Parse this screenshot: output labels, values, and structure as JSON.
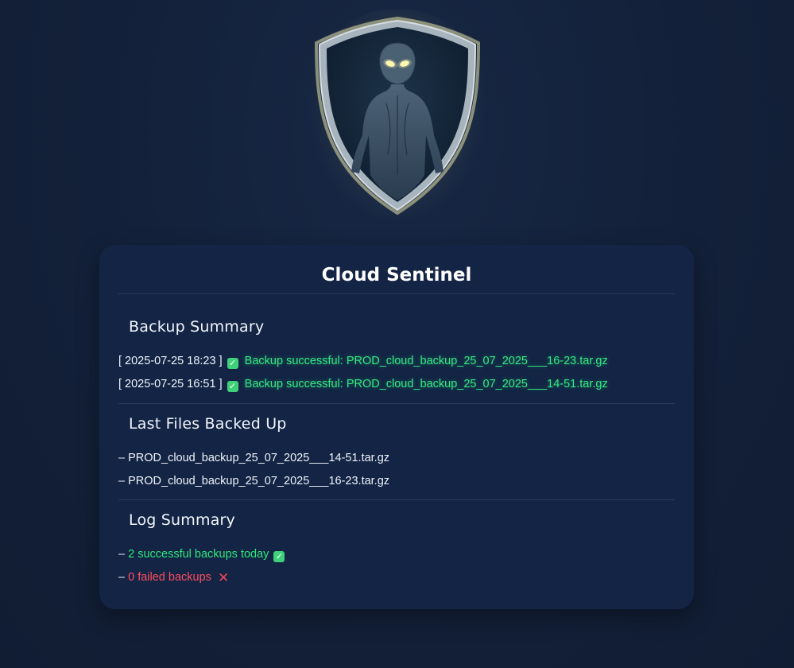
{
  "app": {
    "title": "Cloud Sentinel",
    "logo_icon": "shield-guardian-icon"
  },
  "colors": {
    "background": "#132039",
    "card": "#132445",
    "success": "#2ee87c",
    "error": "#ff4d5e",
    "logo_glow": "#fff096"
  },
  "backup_summary": {
    "heading": "Backup Summary",
    "entries": [
      {
        "timestamp": "[ 2025-07-25 18:23 ]",
        "status_icon": "check-icon",
        "message": "Backup successful: PROD_cloud_backup_25_07_2025___16-23.tar.gz"
      },
      {
        "timestamp": "[ 2025-07-25 16:51 ]",
        "status_icon": "check-icon",
        "message": "Backup successful: PROD_cloud_backup_25_07_2025___14-51.tar.gz"
      }
    ]
  },
  "last_files": {
    "heading": "Last Files Backed Up",
    "bullet": "–",
    "files": [
      "PROD_cloud_backup_25_07_2025___14-51.tar.gz",
      "PROD_cloud_backup_25_07_2025___16-23.tar.gz"
    ]
  },
  "log_summary": {
    "heading": "Log Summary",
    "bullet": "–",
    "success_text": "2 successful backups today",
    "success_icon": "check-icon",
    "failed_text": "0 failed backups",
    "failed_icon": "cross-icon"
  },
  "icons": {
    "check_glyph": "✓",
    "cross_glyph": "✕"
  }
}
